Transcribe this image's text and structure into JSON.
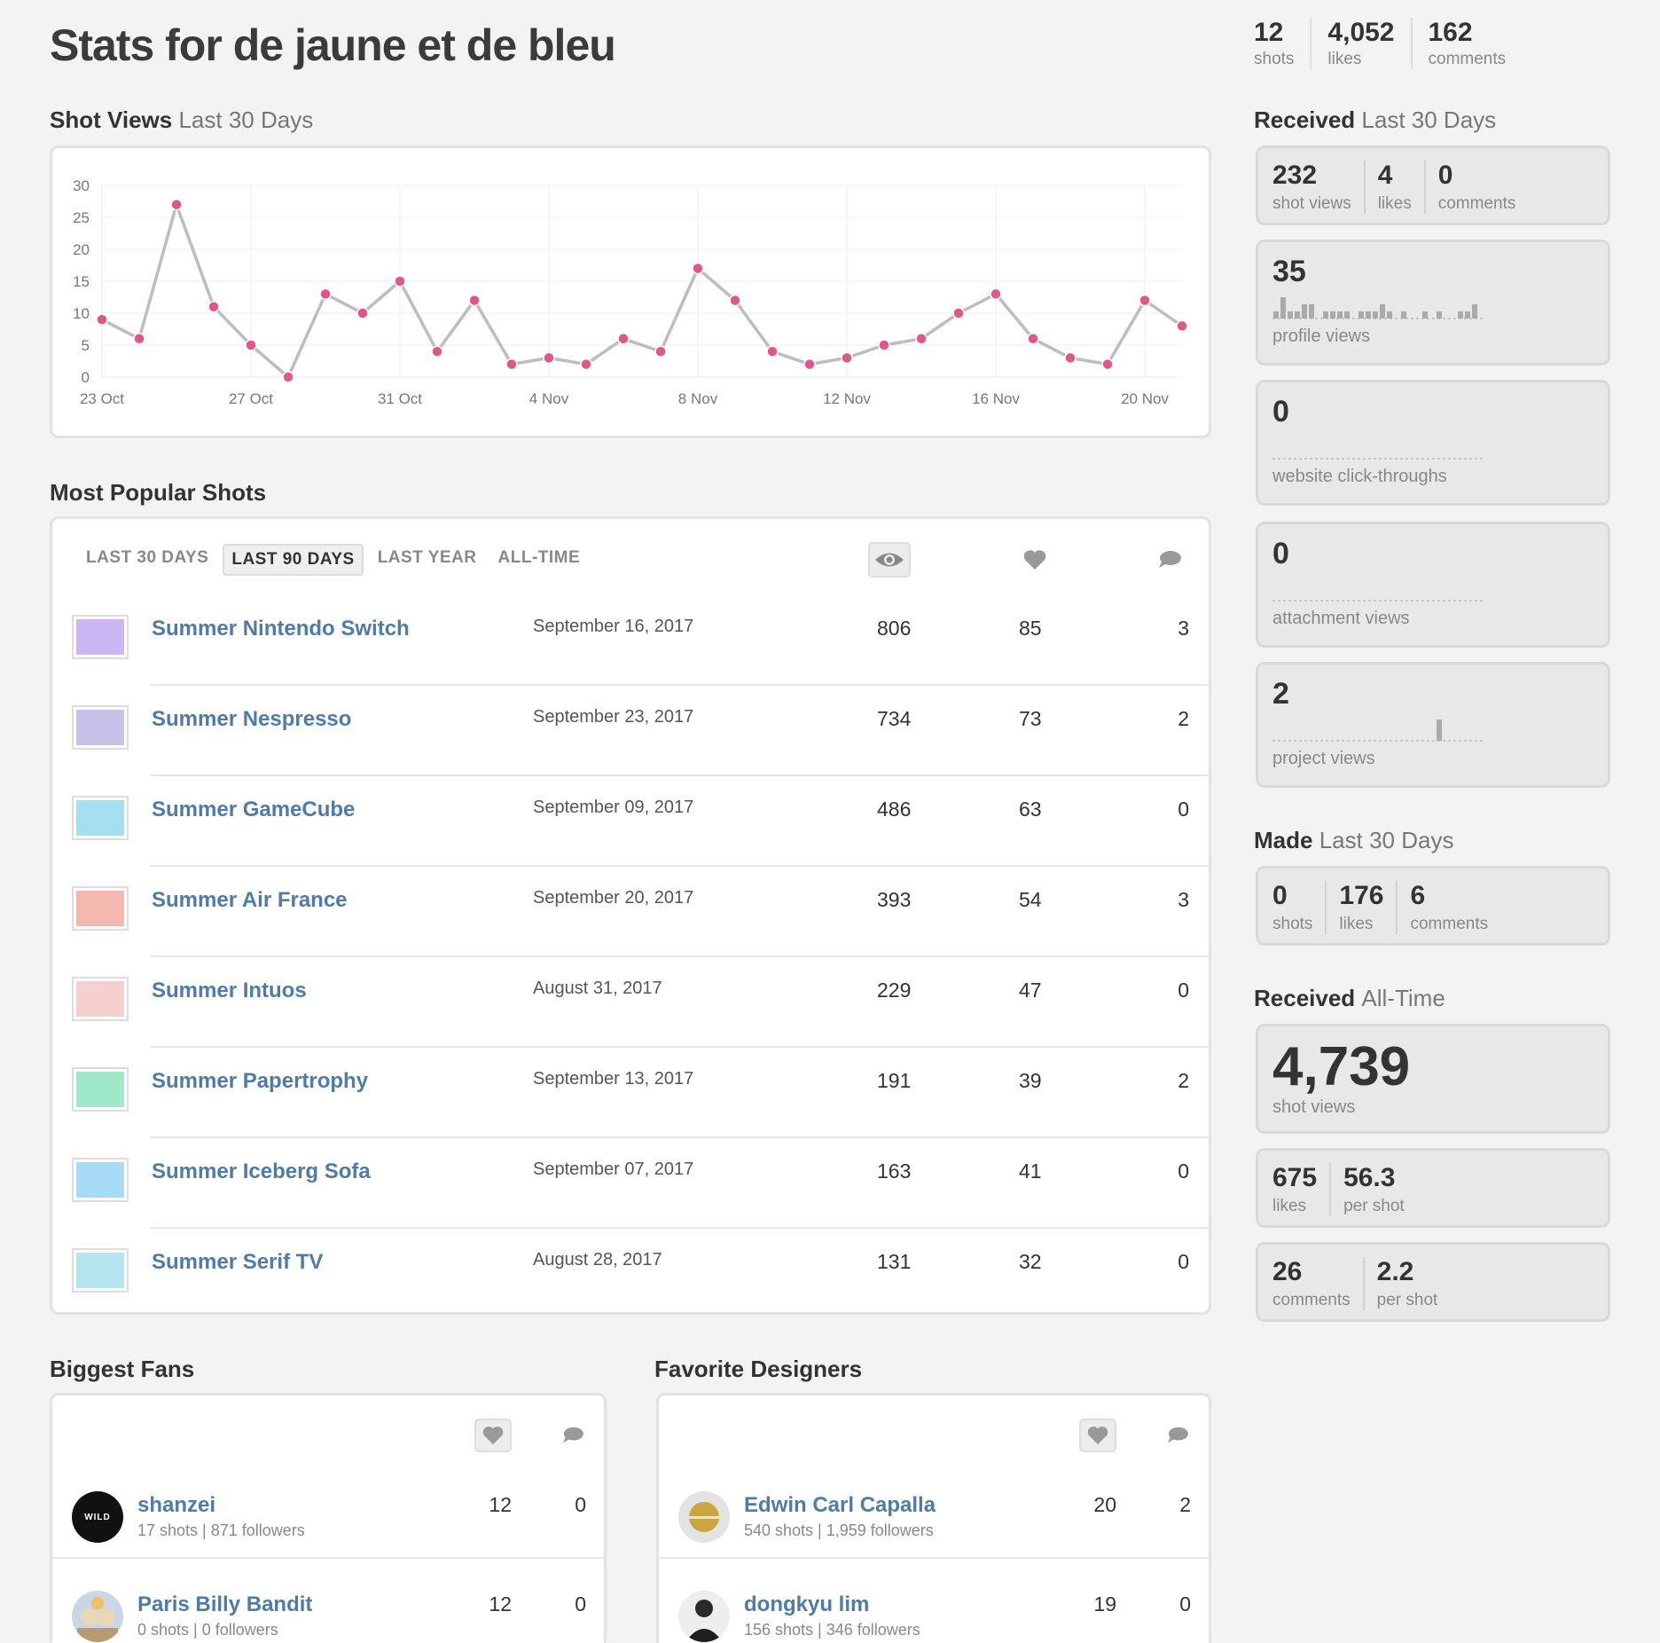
{
  "page": {
    "title": "Stats for de jaune et de bleu"
  },
  "top_stats": [
    {
      "value": "12",
      "label": "shots"
    },
    {
      "value": "4,052",
      "label": "likes"
    },
    {
      "value": "162",
      "label": "comments"
    }
  ],
  "shot_views": {
    "title": "Shot Views",
    "subtitle": "Last 30 Days"
  },
  "chart_data": {
    "type": "line",
    "x": [
      "23 Oct",
      "24 Oct",
      "25 Oct",
      "26 Oct",
      "27 Oct",
      "28 Oct",
      "29 Oct",
      "30 Oct",
      "31 Oct",
      "1 Nov",
      "2 Nov",
      "3 Nov",
      "4 Nov",
      "5 Nov",
      "6 Nov",
      "7 Nov",
      "8 Nov",
      "9 Nov",
      "10 Nov",
      "11 Nov",
      "12 Nov",
      "13 Nov",
      "14 Nov",
      "15 Nov",
      "16 Nov",
      "17 Nov",
      "18 Nov",
      "19 Nov",
      "20 Nov",
      "21 Nov"
    ],
    "x_tick_labels": [
      "23 Oct",
      "27 Oct",
      "31 Oct",
      "4 Nov",
      "8 Nov",
      "12 Nov",
      "16 Nov",
      "20 Nov"
    ],
    "y_tick_labels": [
      "0",
      "5",
      "10",
      "15",
      "20",
      "25",
      "30"
    ],
    "values": [
      9,
      6,
      27,
      11,
      5,
      0,
      13,
      10,
      15,
      4,
      12,
      2,
      3,
      2,
      6,
      4,
      17,
      12,
      4,
      2,
      3,
      5,
      6,
      10,
      13,
      6,
      3,
      2,
      12,
      8
    ],
    "ylim": [
      0,
      30
    ],
    "grid": true,
    "colors": {
      "line": "#bdbdbd",
      "point": "#e05689"
    }
  },
  "popular": {
    "title": "Most Popular Shots",
    "tabs": [
      {
        "label": "LAST 30 DAYS",
        "active": false
      },
      {
        "label": "LAST 90 DAYS",
        "active": true
      },
      {
        "label": "LAST YEAR",
        "active": false
      },
      {
        "label": "ALL-TIME",
        "active": false
      }
    ],
    "columns": [
      "eye-icon",
      "heart-icon",
      "comment-icon"
    ],
    "rows": [
      {
        "name": "Summer Nintendo Switch",
        "date": "September 16, 2017",
        "views": "806",
        "likes": "85",
        "comments": "3",
        "thumb": "#c9b6f2"
      },
      {
        "name": "Summer Nespresso",
        "date": "September 23, 2017",
        "views": "734",
        "likes": "73",
        "comments": "2",
        "thumb": "#c8c2ea"
      },
      {
        "name": "Summer GameCube",
        "date": "September 09, 2017",
        "views": "486",
        "likes": "63",
        "comments": "0",
        "thumb": "#a5dff0"
      },
      {
        "name": "Summer Air France",
        "date": "September 20, 2017",
        "views": "393",
        "likes": "54",
        "comments": "3",
        "thumb": "#f5b8b0"
      },
      {
        "name": "Summer Intuos",
        "date": "August 31, 2017",
        "views": "229",
        "likes": "47",
        "comments": "0",
        "thumb": "#f6cfcf"
      },
      {
        "name": "Summer Papertrophy",
        "date": "September 13, 2017",
        "views": "191",
        "likes": "39",
        "comments": "2",
        "thumb": "#9fe8c9"
      },
      {
        "name": "Summer Iceberg Sofa",
        "date": "September 07, 2017",
        "views": "163",
        "likes": "41",
        "comments": "0",
        "thumb": "#a8dbf5"
      },
      {
        "name": "Summer Serif TV",
        "date": "August 28, 2017",
        "views": "131",
        "likes": "32",
        "comments": "0",
        "thumb": "#b5e6ef"
      }
    ]
  },
  "received_30": {
    "title": "Received",
    "subtitle": "Last 30 Days",
    "stats": [
      {
        "value": "232",
        "label": "shot views"
      },
      {
        "value": "4",
        "label": "likes"
      },
      {
        "value": "0",
        "label": "comments"
      }
    ],
    "profile_views": {
      "value": "35",
      "label": "profile views",
      "spark": [
        1,
        3,
        1,
        1,
        2,
        2,
        0,
        1,
        1,
        1,
        1,
        0,
        1,
        1,
        1,
        2,
        1,
        0,
        1,
        0,
        0,
        1,
        0,
        1,
        0,
        0,
        1,
        1,
        2,
        0
      ]
    },
    "website_clicks": {
      "value": "0",
      "label": "website click-throughs"
    },
    "attachment_views": {
      "value": "0",
      "label": "attachment views"
    },
    "project_views": {
      "value": "2",
      "label": "project views",
      "spark": [
        0,
        0,
        0,
        0,
        0,
        0,
        0,
        0,
        0,
        0,
        0,
        0,
        0,
        0,
        0,
        0,
        0,
        0,
        0,
        0,
        0,
        0,
        0,
        2,
        0,
        0,
        0,
        0,
        0,
        0
      ]
    }
  },
  "made_30": {
    "title": "Made",
    "subtitle": "Last 30 Days",
    "stats": [
      {
        "value": "0",
        "label": "shots"
      },
      {
        "value": "176",
        "label": "likes"
      },
      {
        "value": "6",
        "label": "comments"
      }
    ]
  },
  "received_all": {
    "title": "Received",
    "subtitle": "All-Time",
    "shot_views": {
      "value": "4,739",
      "label": "shot views"
    },
    "likes": [
      {
        "value": "675",
        "label": "likes"
      },
      {
        "value": "56.3",
        "label": "per shot"
      }
    ],
    "comments": [
      {
        "value": "26",
        "label": "comments"
      },
      {
        "value": "2.2",
        "label": "per shot"
      }
    ]
  },
  "fans": {
    "title": "Biggest Fans",
    "rows": [
      {
        "name": "shanzei",
        "meta": "17 shots | 871 followers",
        "likes": "12",
        "comments": "0",
        "avatar_text": "WILD",
        "avatar_color": "#111111"
      },
      {
        "name": "Paris Billy Bandit",
        "meta": "0 shots | 0 followers",
        "likes": "12",
        "comments": "0",
        "avatar_text": "",
        "avatar_color": "#c9d6e6"
      }
    ]
  },
  "designers": {
    "title": "Favorite Designers",
    "rows": [
      {
        "name": "Edwin Carl Capalla",
        "meta": "540 shots | 1,959 followers",
        "likes": "20",
        "comments": "2",
        "avatar_text": "",
        "avatar_color": "#e3e3e3"
      },
      {
        "name": "dongkyu lim",
        "meta": "156 shots | 346 followers",
        "likes": "19",
        "comments": "0",
        "avatar_text": "",
        "avatar_color": "#eeeeee"
      }
    ]
  }
}
